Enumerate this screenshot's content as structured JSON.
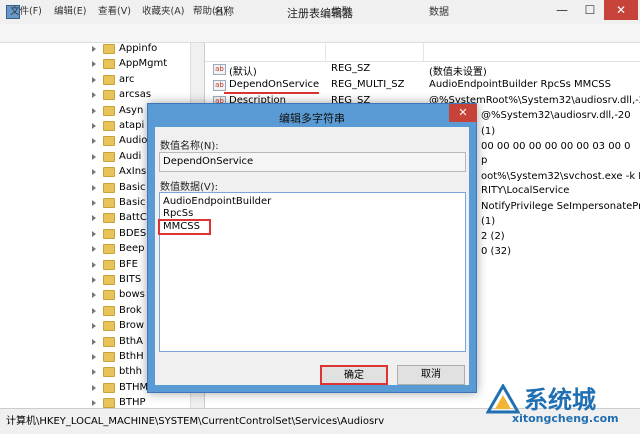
{
  "window": {
    "title": "注册表编辑器",
    "min_glyph": "—",
    "max_glyph": "☐",
    "close_glyph": "✕"
  },
  "menu": [
    "文件(F)",
    "编辑(E)",
    "查看(V)",
    "收藏夹(A)",
    "帮助(H)"
  ],
  "tree": {
    "items": [
      "Appinfo",
      "AppMgmt",
      "arc",
      "arcsas",
      "Asyn",
      "atapi",
      "Audio",
      "Audi",
      "AxIns",
      "Basic",
      "Basic",
      "BattC",
      "BDES",
      "Beep",
      "BFE",
      "BITS",
      "bows",
      "Brok",
      "Brow",
      "BthA",
      "BthH",
      "bthh",
      "BTHM",
      "BTHP"
    ]
  },
  "list": {
    "columns": [
      "名称",
      "类型",
      "数据"
    ],
    "rows": [
      {
        "name": "(默认)",
        "type": "REG_SZ",
        "data": "(数值未设置)"
      },
      {
        "name": "DependOnService",
        "type": "REG_MULTI_SZ",
        "data": "AudioEndpointBuilder RpcSs MMCSS"
      },
      {
        "name": "Description",
        "type": "REG_SZ",
        "data": "@%SystemRoot%\\System32\\audiosrv.dll,-20"
      }
    ],
    "visible_fragments": [
      "@%System32\\audiosrv.dll,-20",
      "(1)",
      "00 00 00 00 00 00 00 03 00 0",
      "p",
      "oot%\\System32\\svchost.exe -k Lo",
      "RITY\\LocalService",
      "NotifyPrivilege SeImpersonatePriv",
      "(1)",
      "2 (2)",
      "0 (32)"
    ]
  },
  "status": {
    "path": "计算机\\HKEY_LOCAL_MACHINE\\SYSTEM\\CurrentControlSet\\Services\\Audiosrv"
  },
  "dialog": {
    "title": "编辑多字符串",
    "close_glyph": "✕",
    "name_label": "数值名称(N):",
    "name_value": "DependOnService",
    "data_label": "数值数据(V):",
    "data_lines": [
      "AudioEndpointBuilder",
      "RpcSs",
      "MMCSS"
    ],
    "ok": "确定",
    "cancel": "取消"
  },
  "watermark": {
    "name": "系统城",
    "url": "xitongcheng.com"
  },
  "colors": {
    "highlight": "#dd3333",
    "dialog_frame": "#5b9bd5",
    "watermark": "#1f6fb2"
  }
}
